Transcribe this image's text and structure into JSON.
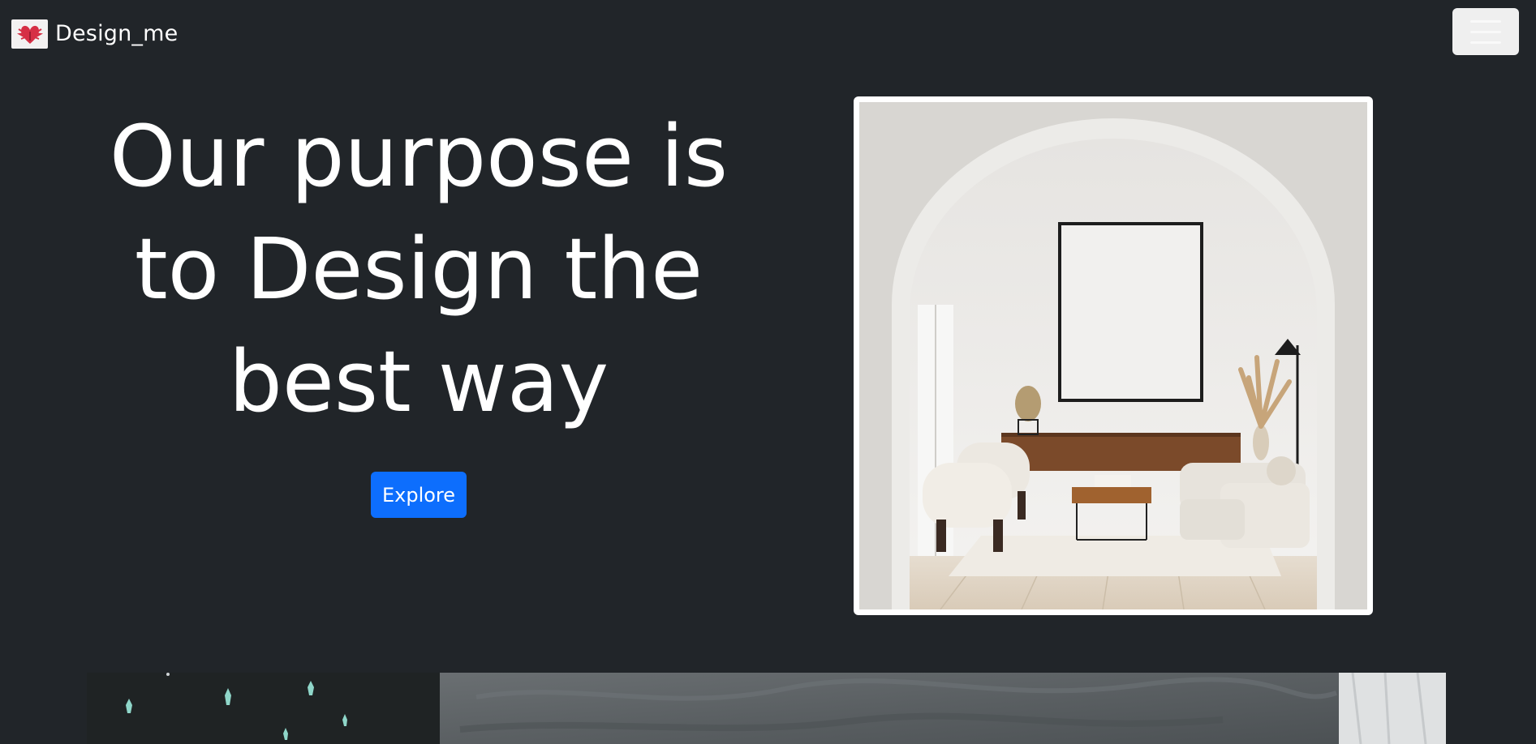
{
  "navbar": {
    "brand_text": "Design_me",
    "brand_logo_icon": "heart-wings-logo-icon",
    "toggler_icon": "hamburger-menu-icon"
  },
  "hero": {
    "title": "Our purpose is to Design the best way",
    "button_label": "Explore",
    "image_description_icon": "living-room-arch-image"
  },
  "gallery": {
    "image_icon": "interior-wall-photo"
  },
  "colors": {
    "background": "#212529",
    "primary_button": "#0d6efd",
    "text": "#ffffff"
  }
}
